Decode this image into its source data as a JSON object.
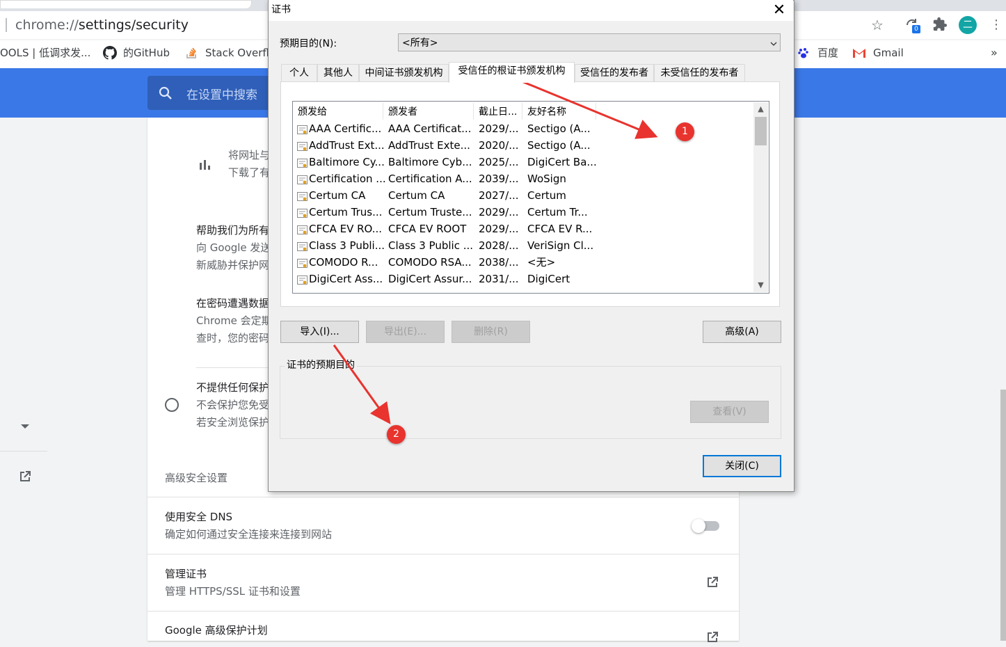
{
  "browser": {
    "url_prefix": "chrome://",
    "url_path": "settings/security",
    "extension_badge": "0",
    "profile_initial": "二",
    "bookmarks": [
      {
        "label": "OOLS | 低调求发..."
      },
      {
        "label": "的GitHub"
      },
      {
        "label": "Stack Overflo"
      },
      {
        "label": "百度"
      },
      {
        "label": "Gmail"
      }
    ],
    "bookmarks_more": "»"
  },
  "settings": {
    "search_placeholder": "在设置中搜索",
    "rows": {
      "r1_line1": "将网址与",
      "r1_line2": "下载了有",
      "r2_title": "帮助我们为所有",
      "r2_line1": "向 Google 发送",
      "r2_line2": "新威胁并保护网",
      "r3_title": "在密码遭遇数据",
      "r3_line1": "Chrome 会定期",
      "r3_line2": "查时，您的密码",
      "r4_title": "不提供任何保护",
      "r4_line1": "不会保护您免受",
      "r4_line2": "若安全浏览保护"
    },
    "advanced_header": "高级安全设置",
    "dns_title": "使用安全 DNS",
    "dns_desc": "确定如何通过安全连接来连接到网站",
    "certs_title": "管理证书",
    "certs_desc": "管理 HTTPS/SSL 证书和设置",
    "gapp_title": "Google 高级保护计划"
  },
  "dialog": {
    "title": "证书",
    "purpose_label": "预期目的(N):",
    "purpose_value": "<所有>",
    "tabs": [
      "个人",
      "其他人",
      "中间证书颁发机构",
      "受信任的根证书颁发机构",
      "受信任的发布者",
      "未受信任的发布者"
    ],
    "active_tab": 3,
    "columns": [
      "颁发给",
      "颁发者",
      "截止日...",
      "友好名称"
    ],
    "rows": [
      [
        "AAA Certific...",
        "AAA Certificat...",
        "2029/...",
        "Sectigo (A..."
      ],
      [
        "AddTrust Ext...",
        "AddTrust Exte...",
        "2020/...",
        "Sectigo (A..."
      ],
      [
        "Baltimore Cy...",
        "Baltimore Cyb...",
        "2025/...",
        "DigiCert Ba..."
      ],
      [
        "Certification ...",
        "Certification A...",
        "2039/...",
        "WoSign"
      ],
      [
        "Certum CA",
        "Certum CA",
        "2027/...",
        "Certum"
      ],
      [
        "Certum Trus...",
        "Certum Truste...",
        "2029/...",
        "Certum Tr..."
      ],
      [
        "CFCA EV RO...",
        "CFCA EV ROOT",
        "2029/...",
        "CFCA EV R..."
      ],
      [
        "Class 3 Publi...",
        "Class 3 Public ...",
        "2028/...",
        "VeriSign Cl..."
      ],
      [
        "COMODO R...",
        "COMODO RSA...",
        "2038/...",
        "<无>"
      ],
      [
        "DigiCert Ass...",
        "DigiCert Assur...",
        "2031/...",
        "DigiCert"
      ]
    ],
    "buttons": {
      "import": "导入(I)...",
      "export": "导出(E)...",
      "remove": "删除(R)",
      "advanced": "高级(A)",
      "view": "查看(V)",
      "close": "关闭(C)"
    },
    "purposes_group": "证书的预期目的"
  },
  "annotations": {
    "badge1": "1",
    "badge2": "2",
    "color": "#e8332e"
  },
  "colors": {
    "settings_blue": "#3b78e7",
    "default_button_border": "#0078d7"
  }
}
